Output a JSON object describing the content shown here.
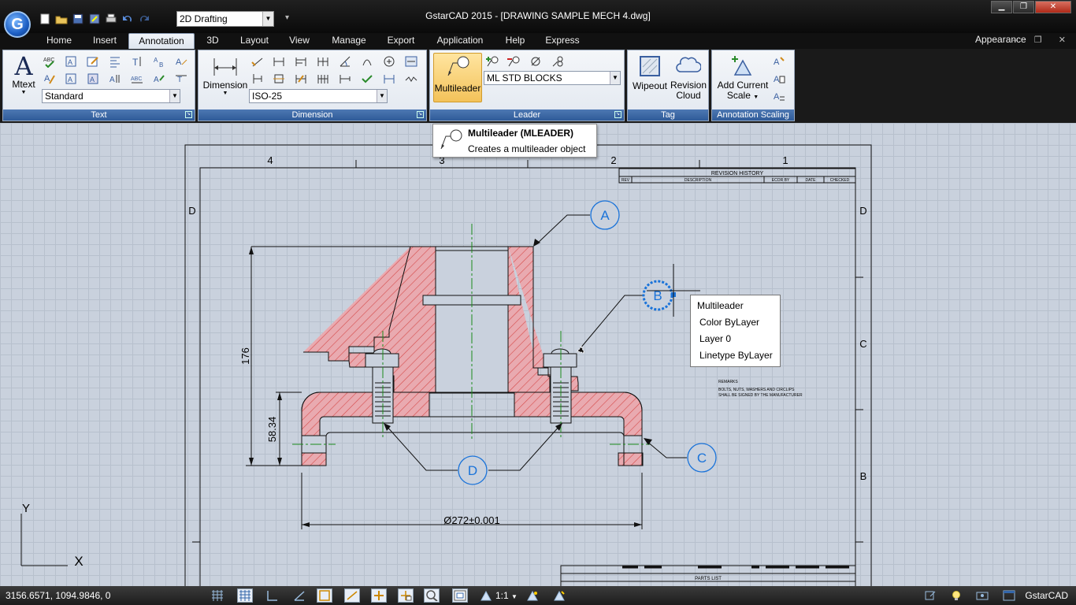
{
  "window": {
    "title": "GstarCAD 2015 - [DRAWING SAMPLE MECH 4.dwg]",
    "app_logo": "G"
  },
  "quick_access": {
    "workspace": "2D Drafting",
    "icons": [
      "new-icon",
      "open-icon",
      "save-icon",
      "save-as-icon",
      "print-icon",
      "undo-icon",
      "redo-icon"
    ]
  },
  "tabs": [
    {
      "label": "Home",
      "active": false
    },
    {
      "label": "Insert",
      "active": false
    },
    {
      "label": "Annotation",
      "active": true
    },
    {
      "label": "3D",
      "active": false
    },
    {
      "label": "Layout",
      "active": false
    },
    {
      "label": "View",
      "active": false
    },
    {
      "label": "Manage",
      "active": false
    },
    {
      "label": "Export",
      "active": false
    },
    {
      "label": "Application",
      "active": false
    },
    {
      "label": "Help",
      "active": false
    },
    {
      "label": "Express",
      "active": false
    }
  ],
  "appearance_label": "Appearance",
  "panels": {
    "text": {
      "title": "Text",
      "mtext_label": "Mtext",
      "style_value": "Standard",
      "mtext_glyph": "A"
    },
    "dimension": {
      "title": "Dimension",
      "dim_label": "Dimension",
      "style_value": "ISO-25"
    },
    "leader": {
      "title": "Leader",
      "multileader_label": "Multileader",
      "style_value": "ML STD BLOCKS"
    },
    "tag": {
      "title": "Tag",
      "wipeout_label": "Wipeout",
      "revision_label_1": "Revision",
      "revision_label_2": "Cloud"
    },
    "scaling": {
      "title": "Annotation Scaling",
      "add_scale_1": "Add Current",
      "add_scale_2": "Scale"
    }
  },
  "tooltip": {
    "title": "Multileader (MLEADER)",
    "description": "Creates a multileader object"
  },
  "quick_properties": {
    "title": "Multileader",
    "color": "Color  ByLayer",
    "layer": "Layer  0",
    "linetype": "Linetype  ByLayer"
  },
  "drawing": {
    "col_labels": [
      "4",
      "3",
      "2",
      "1"
    ],
    "row_labels": [
      "D",
      "C",
      "B"
    ],
    "balloons": [
      "A",
      "B",
      "C",
      "D"
    ],
    "dim_height": "176",
    "dim_base": "58.34",
    "dim_diameter": "Ø272±0.001",
    "revision_history": "REVISION HISTORY",
    "rev_cols": [
      "REV",
      "DESCRIPTION",
      "ECOR BY",
      "DATE",
      "CHECKED"
    ],
    "notes_title": "REMARKS",
    "notes_line1": "BOLTS, NUTS, WASHERS AND CIRCLIPS",
    "notes_line2": "SHALL BE SIGNED BY THE MANUFACTURER",
    "parts_list": "PARTS LIST",
    "ucs_y": "Y",
    "ucs_x": "X"
  },
  "statusbar": {
    "coords": "3156.6571, 1094.9846, 0",
    "scale": "1:1",
    "brand": "GstarCAD"
  },
  "colors": {
    "hatch": "#d64a4a",
    "balloon": "#1a73d9",
    "ribbon_title": "#2f5b98",
    "canvas": "#c9d1dd"
  }
}
